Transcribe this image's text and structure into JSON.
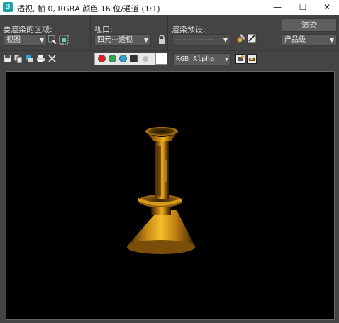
{
  "titlebar": {
    "app_icon_letter": "3",
    "title": "透视, 帧 0, RGBA 颜色 16 位/通道 (1:1)",
    "minimize_glyph": "—",
    "maximize_glyph": "☐",
    "close_glyph": "✕"
  },
  "render_panel": {
    "area_label": "要渲染的区域:",
    "area_value": "视图",
    "viewport_label": "视口:",
    "viewport_value": "四元⋯透视",
    "preset_label": "渲染预设:",
    "preset_value": "---------------",
    "render_button": "渲染",
    "quality_value": "产品级"
  },
  "toolbar": {
    "channel_display": "RGB Alpha",
    "channels": [
      {
        "name": "red",
        "color": "#e02020"
      },
      {
        "name": "green",
        "color": "#2ea84a"
      },
      {
        "name": "blue",
        "color": "#27a7d6"
      },
      {
        "name": "alpha",
        "color": "#333333"
      }
    ],
    "mono_dot_color": "#cfcfcf",
    "background_swatch_color": "#ffffff"
  },
  "viewport": {
    "background": "#000000",
    "object": "brass candlestick"
  }
}
